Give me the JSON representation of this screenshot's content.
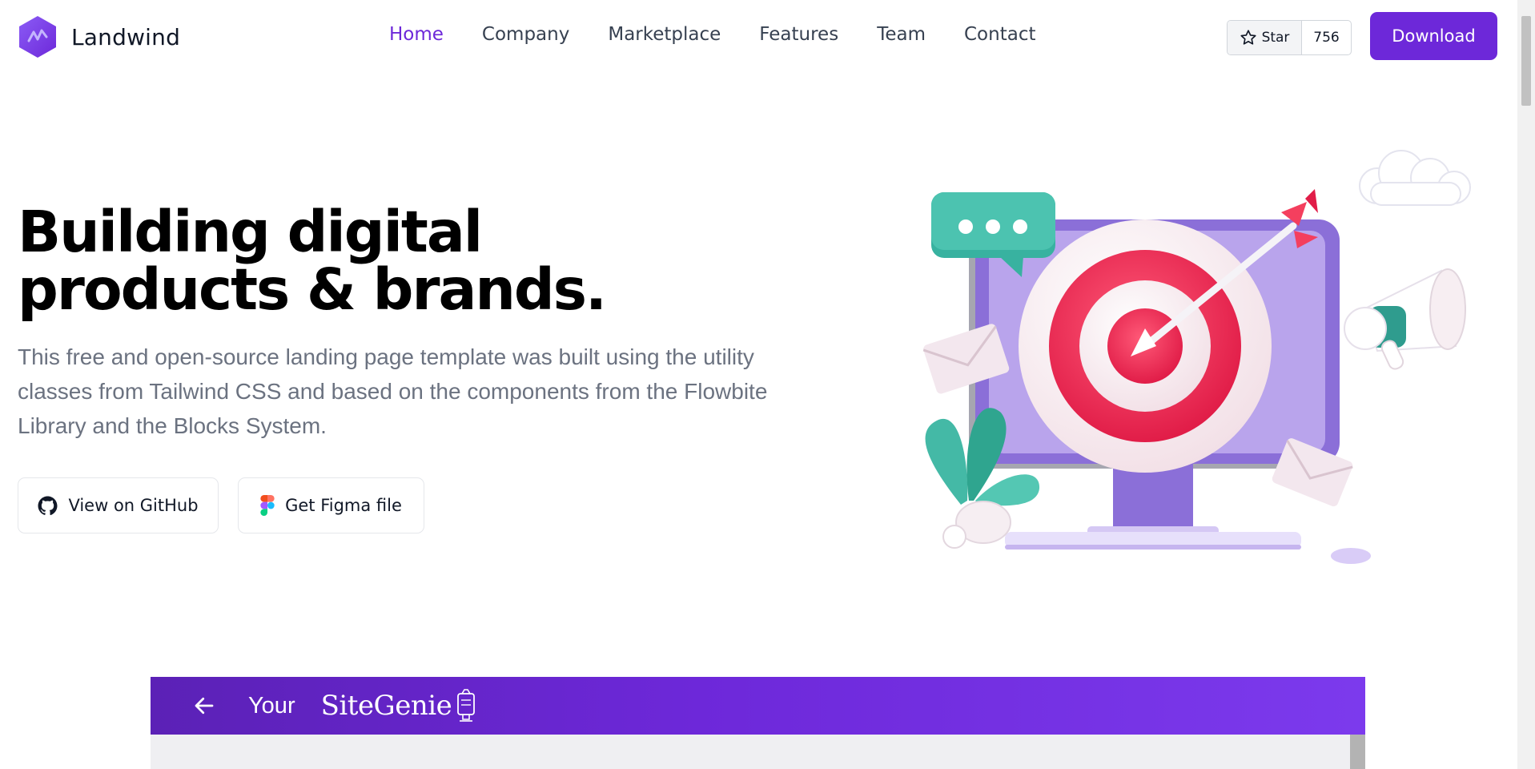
{
  "header": {
    "brand": "Landwind",
    "nav": [
      {
        "label": "Home",
        "active": true
      },
      {
        "label": "Company",
        "active": false
      },
      {
        "label": "Marketplace",
        "active": false
      },
      {
        "label": "Features",
        "active": false
      },
      {
        "label": "Team",
        "active": false
      },
      {
        "label": "Contact",
        "active": false
      }
    ],
    "star_label": "Star",
    "star_count": "756",
    "download_label": "Download"
  },
  "hero": {
    "title_line1": "Building digital",
    "title_line2": "products & brands.",
    "description": "This free and open-source landing page template was built using the utility classes from Tailwind CSS and based on the components from the Flowbite Library and the Blocks System.",
    "github_label": "View on GitHub",
    "figma_label": "Get Figma file"
  },
  "banner": {
    "your_label": "Your",
    "brand": "SiteGenie"
  },
  "colors": {
    "accent": "#6d28d9",
    "text": "#111827",
    "muted": "#6b7280"
  },
  "icons": [
    "logo-icon",
    "star-icon",
    "github-icon",
    "figma-icon",
    "arrow-left-icon",
    "lamp-icon"
  ]
}
